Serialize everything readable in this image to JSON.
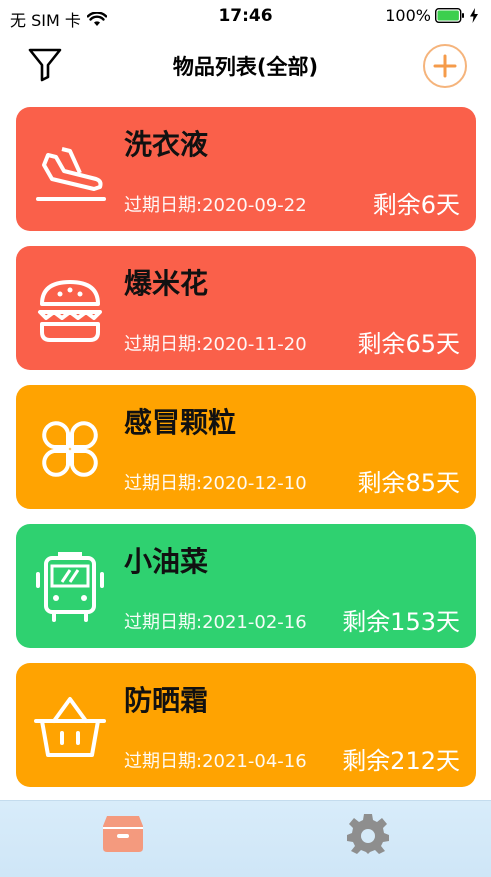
{
  "status": {
    "carrier": "无 SIM 卡",
    "time": "17:46",
    "battery": "100%"
  },
  "nav": {
    "title": "物品列表(全部)",
    "filter_icon": "filter-icon",
    "add_icon": "plus-circle-icon"
  },
  "items": [
    {
      "name": "洗衣液",
      "expiry": "过期日期:2020-09-22",
      "remain": "剩余6天",
      "color": "#fa604a",
      "icon": "plane-landing-icon"
    },
    {
      "name": "爆米花",
      "expiry": "过期日期:2020-11-20",
      "remain": "剩余65天",
      "color": "#fa604a",
      "icon": "burger-icon"
    },
    {
      "name": "感冒颗粒",
      "expiry": "过期日期:2020-12-10",
      "remain": "剩余85天",
      "color": "#ffa301",
      "icon": "clover-icon"
    },
    {
      "name": "小油菜",
      "expiry": "过期日期:2021-02-16",
      "remain": "剩余153天",
      "color": "#2fd170",
      "icon": "bus-icon"
    },
    {
      "name": "防晒霜",
      "expiry": "过期日期:2021-04-16",
      "remain": "剩余212天",
      "color": "#ffa301",
      "icon": "basket-icon"
    }
  ],
  "tabs": [
    {
      "name": "list-tab",
      "icon": "box-icon",
      "active": true,
      "color": "#f49a7e"
    },
    {
      "name": "settings-tab",
      "icon": "gear-icon",
      "active": false,
      "color": "#8e8e8e"
    }
  ]
}
